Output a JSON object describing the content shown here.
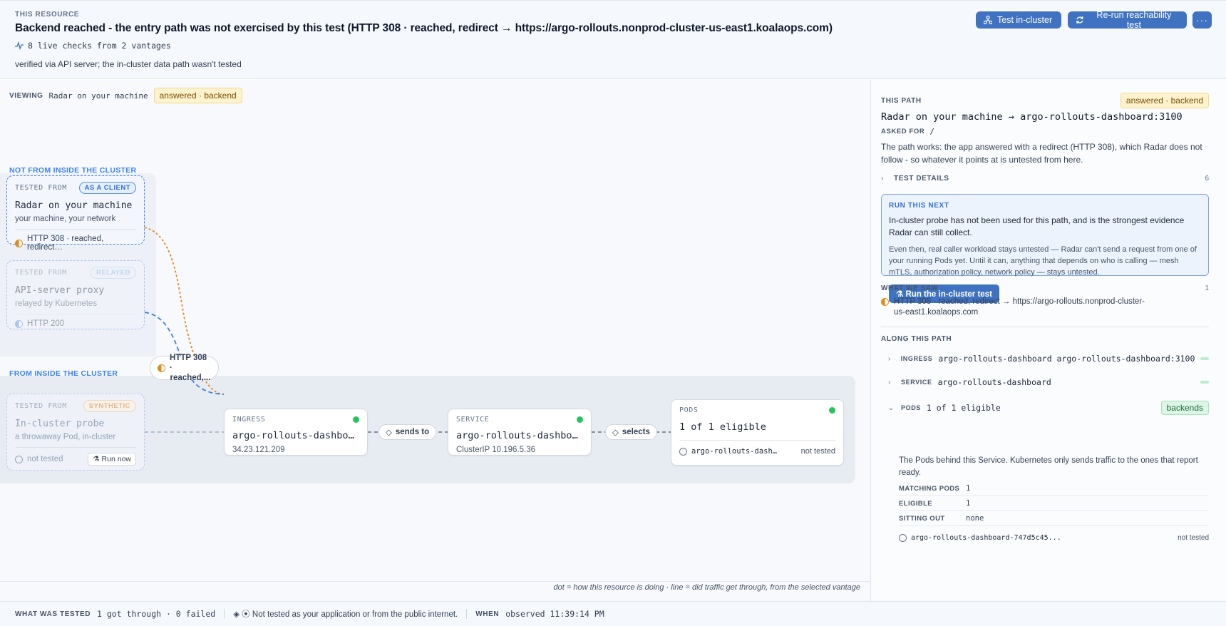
{
  "header": {
    "kicker": "THIS RESOURCE",
    "title": "Backend reached - the entry path was not exercised by this test (HTTP 308 · reached, redirect → https://argo-rollouts.nonprod-cluster-us-east1.koalaops.com)",
    "meta": "8 live checks from 2 vantages",
    "subtitle": "verified via API server; the in-cluster data path wasn't tested",
    "buttons": {
      "test_in_cluster": "Test in-cluster",
      "rerun": "Re-run reachability test",
      "more": "···"
    }
  },
  "canvas": {
    "viewing_label": "VIEWING",
    "viewing_value": "Radar on your machine",
    "viewing_badge": "answered · backend",
    "zone_outside": "NOT FROM INSIDE THE CLUSTER",
    "zone_inside": "FROM INSIDE THE CLUSTER",
    "sources": [
      {
        "kicker": "TESTED FROM",
        "tag": "AS A CLIENT",
        "name": "Radar on your machine",
        "sub": "your machine, your network",
        "status": "HTTP 308 · reached, redirect…"
      },
      {
        "kicker": "TESTED FROM",
        "tag": "RELAYED",
        "name": "API-server proxy",
        "sub": "relayed by Kubernetes",
        "status": "HTTP 200"
      },
      {
        "kicker": "TESTED FROM",
        "tag": "SYNTHETIC",
        "name": "In-cluster probe",
        "sub": "a throwaway Pod, in-cluster",
        "status": "not tested",
        "action": "⚗ Run now"
      }
    ],
    "edge_badge": {
      "line1": "HTTP 308 ·",
      "line2": "reached,..."
    },
    "nodes": [
      {
        "kind": "INGRESS",
        "name": "argo-rollouts-dashboard",
        "detail": "34.23.121.209"
      },
      {
        "kind": "SERVICE",
        "name": "argo-rollouts-dashboard",
        "detail": "ClusterIP 10.196.5.36"
      },
      {
        "kind": "PODS",
        "name": "1 of 1 eligible",
        "pod": "argo-rollouts-dashboard",
        "pod_status": "not tested"
      }
    ],
    "connectors": [
      "sends to",
      "selects"
    ],
    "legend": "dot = how this resource is doing · line = did traffic get through, from the selected vantage"
  },
  "panel": {
    "title": "THIS PATH",
    "badge": "answered · backend",
    "path": "Radar on your machine → argo-rollouts-dashboard:3100",
    "asked_for_label": "ASKED FOR",
    "asked_for_value": "/",
    "description": "The path works: the app answered with a redirect (HTTP 308), which Radar does not follow - so whatever it points at is untested from here.",
    "test_details_label": "TEST DETAILS",
    "test_details_count": "6",
    "run_next": {
      "label": "RUN THIS NEXT",
      "text1": "In-cluster probe has not been used for this path, and is the strongest evidence Radar can still collect.",
      "text2": "Even then, real caller workload stays untested — Radar can't send a request from one of your running Pods yet. Until it can, anything that depends on who is calling — mesh mTLS, authorization policy, network policy — stays untested.",
      "button": "⚗ Run the in-cluster test"
    },
    "what_we_saw": {
      "label": "WHAT WE SAW",
      "count": "1",
      "text": "HTTP 308 · reached, redirect → https://argo-rollouts.nonprod-cluster-us-east1.koalaops.com"
    },
    "along": {
      "label": "ALONG THIS PATH",
      "rows": [
        {
          "kind": "INGRESS",
          "value": "argo-rollouts-dashboard argo-rollouts-dashboard:3100"
        },
        {
          "kind": "SERVICE",
          "value": "argo-rollouts-dashboard"
        },
        {
          "kind": "PODS",
          "value": "1 of 1 eligible",
          "chip": "backends"
        }
      ],
      "pods_desc": "The Pods behind this Service. Kubernetes only sends traffic to the ones that report ready.",
      "kv": [
        {
          "k": "MATCHING PODS",
          "v": "1"
        },
        {
          "k": "ELIGIBLE",
          "v": "1"
        },
        {
          "k": "SITTING OUT",
          "v": "none"
        }
      ],
      "pod_name": "argo-rollouts-dashboard-747d5c45...",
      "pod_status": "not tested"
    }
  },
  "footer": {
    "tested_label": "WHAT WAS TESTED",
    "tested_value": "1 got through · 0 failed",
    "note": "◈ ⦿ Not tested as your application or from the public internet.",
    "when_label": "WHEN",
    "when_value": "observed 11:39:14 PM"
  },
  "colors": {
    "accent": "#3f72c0",
    "ok": "#22c55e",
    "warn": "#e08a1c",
    "answered_bg": "#fdf3cf",
    "backends_bg": "#dcf5e5"
  }
}
